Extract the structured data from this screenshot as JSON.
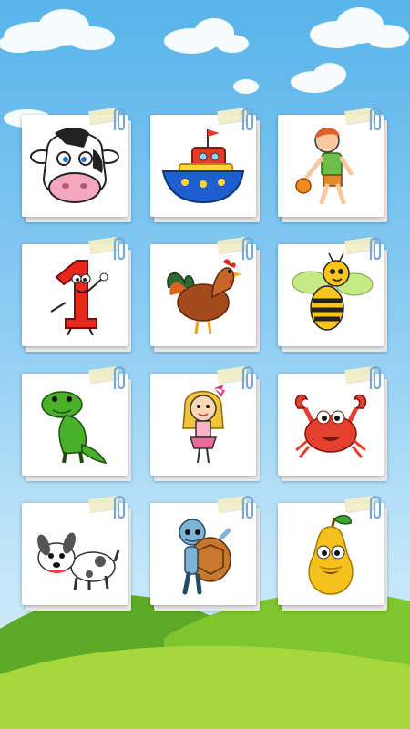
{
  "screen": {
    "name": "coloring-picture-picker"
  },
  "colors": {
    "sky_top": "#58b4ea",
    "sky_bottom": "#d7f0fb",
    "hill_dark": "#6dbb2d",
    "hill_light": "#9fd63c",
    "paper": "#ffffff",
    "clip": "#8ab4d8",
    "tape": "#f3efc8"
  },
  "cards": [
    {
      "id": "cow",
      "icon": "cow-icon"
    },
    {
      "id": "boat",
      "icon": "boat-icon"
    },
    {
      "id": "boy",
      "icon": "boy-with-ball-icon"
    },
    {
      "id": "number-one",
      "icon": "number-one-icon"
    },
    {
      "id": "rooster",
      "icon": "rooster-icon"
    },
    {
      "id": "bee",
      "icon": "bee-icon"
    },
    {
      "id": "dinosaur",
      "icon": "dinosaur-icon"
    },
    {
      "id": "girl",
      "icon": "girl-icon"
    },
    {
      "id": "crab",
      "icon": "crab-icon"
    },
    {
      "id": "dog",
      "icon": "dog-icon"
    },
    {
      "id": "turtle-kid",
      "icon": "turtle-kid-icon"
    },
    {
      "id": "pear",
      "icon": "pear-icon"
    }
  ]
}
